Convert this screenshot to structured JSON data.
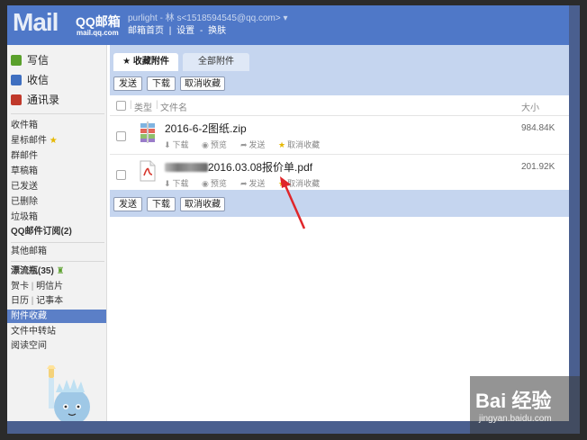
{
  "header": {
    "logo_mail": "Mail",
    "logo_qq": "QQ邮箱",
    "logo_domain": "mail.qq.com",
    "user_line": "purlight - 林 s<1518594545@qq.com> ▾",
    "nav": {
      "home": "邮箱首页",
      "sep": "|",
      "settings": "设置",
      "dash": "-",
      "skin": "换肤"
    }
  },
  "sidebar": {
    "compose": "写信",
    "inbox": "收信",
    "contacts": "通讯录",
    "folders": [
      "收件箱",
      "星标邮件",
      "群邮件",
      "草稿箱",
      "已发送",
      "已删除",
      "垃圾箱",
      "QQ邮件订阅(2)"
    ],
    "other_mailbox": "其他邮箱",
    "bottle": "漂流瓶(35)",
    "card": "贺卡",
    "sep": "|",
    "postcard": "明信片",
    "calendar": "日历",
    "notes": "记事本",
    "attachments_fav": "附件收藏",
    "transfer": "文件中转站",
    "reading": "阅读空间"
  },
  "tabs": {
    "favorites": "★ 收藏附件",
    "all": "全部附件"
  },
  "toolbar": {
    "send": "发送",
    "download": "下载",
    "unfavorite": "取消收藏"
  },
  "columns": {
    "type": "类型",
    "filename": "文件名",
    "size": "大小"
  },
  "files": [
    {
      "name": "2016-6-2图纸.zip",
      "size": "984.84K",
      "actions": {
        "download": "下载",
        "preview": "预览",
        "send": "发送",
        "unfavorite": "取消收藏"
      }
    },
    {
      "name": "2016.03.08报价单.pdf",
      "size": "201.92K",
      "actions": {
        "download": "下载",
        "preview": "预览",
        "send": "发送",
        "unfavorite": "取消收藏"
      }
    }
  ],
  "watermark": {
    "main": "Bai 经验",
    "sub": "jingyan.baidu.com"
  },
  "colors": {
    "header": "#4f78c8",
    "toolbar": "#c5d5ef",
    "active": "#5b7fc7",
    "arrow": "#e0262a",
    "star": "#e6b800"
  },
  "icons": {
    "compose": "compose-icon",
    "inbox": "inbox-icon",
    "contacts": "contacts-icon",
    "zip": "zip-file-icon",
    "pdf": "pdf-file-icon",
    "download": "download-icon",
    "preview": "eye-icon",
    "send": "forward-icon",
    "star": "star-icon"
  }
}
